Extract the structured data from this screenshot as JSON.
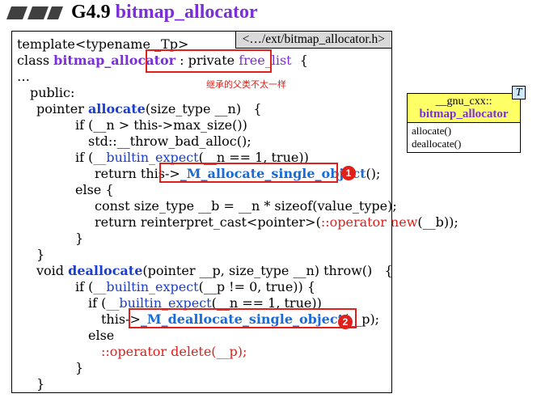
{
  "header": {
    "number": "G4.9",
    "name": "bitmap_allocator"
  },
  "file_tab": "<…/ext/bitmap_allocator.h>",
  "note": "继承的父类不太一样",
  "badges": [
    "1",
    "2"
  ],
  "code": {
    "l1": "template<typename _Tp>",
    "l2_a": "class ",
    "l2_cls": "bitmap_allocator",
    "l2_b": " : private ",
    "l2_base": "free_list",
    "l2_c": "  {",
    "l3": "…",
    "l4": "public:",
    "l5_a": "pointer ",
    "l5_fn": "allocate",
    "l5_b": "(size_type __n)   {",
    "l6": "if (__n > this->max_size())",
    "l7": "std::__throw_bad_alloc();",
    "l8_a": "if (",
    "l8_fn": "__builtin_expect",
    "l8_b": "(__n == 1, true))",
    "l9_a": "return this->",
    "l9_fn": "_M_allocate_single_object",
    "l9_b": "();",
    "l10": "else {",
    "l11": "const size_type __b = __n * sizeof(value_type);",
    "l12_a": "return reinterpret_cast<pointer>(",
    "l12_op": "::operator new",
    "l12_b": "(__b));",
    "l13": "}",
    "l14": "}",
    "l15_a": "void ",
    "l15_fn": "deallocate",
    "l15_b": "(pointer __p, size_type __n) throw()   {",
    "l16_a": "if (",
    "l16_fn": "__builtin_expect",
    "l16_b": "(__p != 0, true)) {",
    "l17_a": "if (",
    "l17_fn": "__builtin_expect",
    "l17_b": "(__n == 1, true))",
    "l18_a": "this->",
    "l18_fn": "_M_deallocate_single_object",
    "l18_b": "(__p);",
    "l19": "else",
    "l20": "::operator delete(__p);",
    "l21": "}",
    "l22": "}"
  },
  "uml": {
    "namespace": "__gnu_cxx::",
    "class_name": "bitmap_allocator",
    "methods": [
      "allocate()",
      "deallocate()"
    ],
    "template_param": "T"
  },
  "colors": {
    "purple": "#7b2fd8",
    "blue": "#1a3fd0",
    "red": "#e0201a",
    "uml_header": "#ffff66"
  }
}
